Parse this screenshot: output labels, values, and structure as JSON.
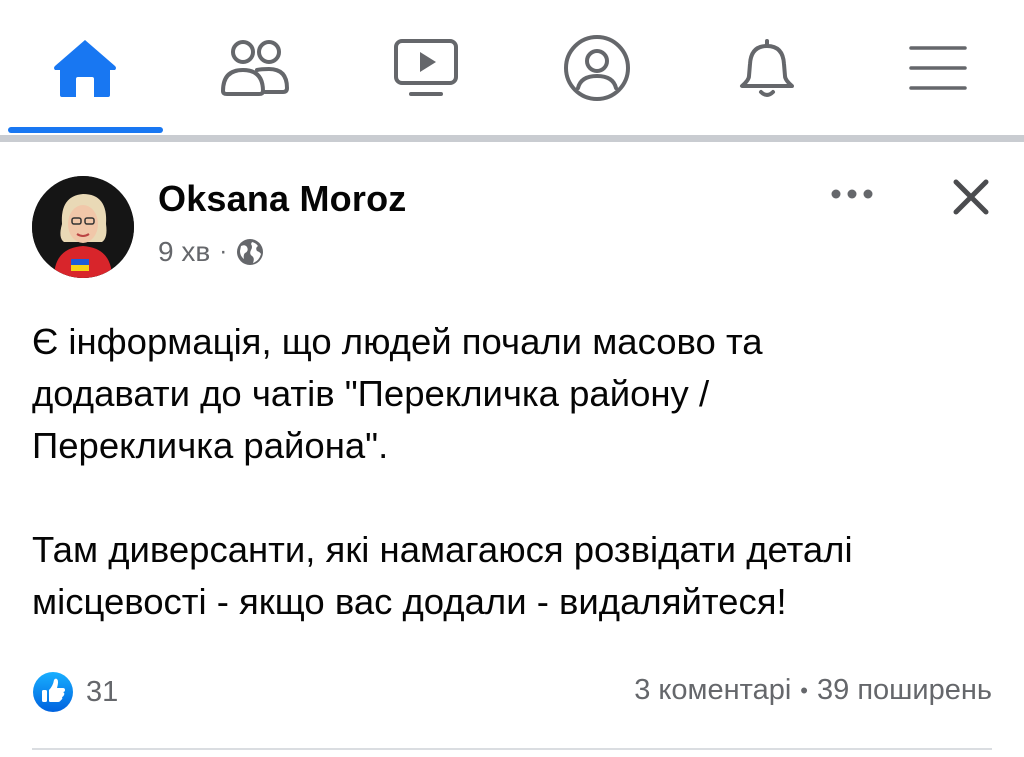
{
  "nav": {
    "items": [
      {
        "icon": "home-icon",
        "active": true
      },
      {
        "icon": "friends-icon",
        "active": false
      },
      {
        "icon": "watch-icon",
        "active": false
      },
      {
        "icon": "profile-icon",
        "active": false
      },
      {
        "icon": "bell-icon",
        "active": false
      },
      {
        "icon": "menu-icon",
        "active": false
      }
    ],
    "active_color": "#1877f2",
    "inactive_color": "#65676b"
  },
  "post": {
    "author": "Oksana Moroz",
    "time": "9 хв",
    "privacy_icon": "globe-icon",
    "paragraphs": [
      [
        "Є інформація, що людей почали масово та",
        "додавати до чатів \"Перекличка району /",
        "Перекличка района\"."
      ],
      [
        "Там диверсанти, які намагаюся розвідати деталі",
        "місцевості - якщо вас додали - видаляйтеся!"
      ]
    ],
    "reactions": {
      "icon": "like-icon",
      "count": "31"
    },
    "comments": "3 коментарі",
    "shares": "39 поширень"
  }
}
